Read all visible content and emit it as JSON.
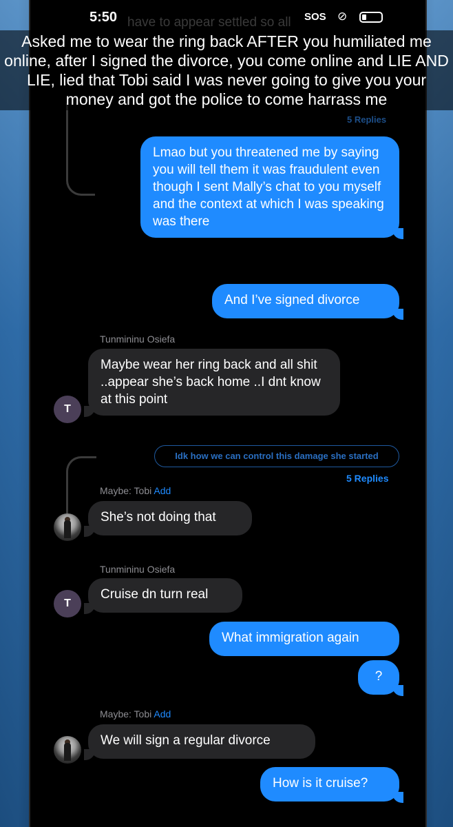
{
  "status_bar": {
    "time": "5:50",
    "sos": "SOS",
    "link_icon": "link-icon",
    "battery_icon": "battery-icon"
  },
  "caption": "Asked me to wear the ring back AFTER you humiliated me online, after I signed the divorce, you come online and LIE AND LIE, lied that Tobi said I was never going to give you your money and got the police to come harrass me",
  "ghost": {
    "text": "have to appear settled so all",
    "replies": "5 Replies"
  },
  "messages": [
    {
      "type": "sent",
      "text": "Lmao but you threatened me by saying you will tell them it was fraudulent even though I sent Mally’s chat to you myself and the context at which I was speaking was there"
    },
    {
      "type": "sent",
      "text": "And I’ve signed divorce"
    },
    {
      "type": "received",
      "sender": "Tunmininu Osiefa",
      "avatar": "T",
      "text": "Maybe wear her ring back and all shit ..appear she’s back home ..I dnt know at this point"
    },
    {
      "type": "thread",
      "text": "Idk how we can control this damage she started",
      "replies": "5 Replies"
    },
    {
      "type": "received",
      "sender": "Maybe: Tobi",
      "sender_action": "Add",
      "text": "She’s not doing that"
    },
    {
      "type": "received",
      "sender": "Tunmininu Osiefa",
      "avatar": "T",
      "text": "Cruise dn turn real"
    },
    {
      "type": "sent",
      "text": "What immigration again"
    },
    {
      "type": "sent",
      "text": "?"
    },
    {
      "type": "received",
      "sender": "Maybe: Tobi",
      "sender_action": "Add",
      "text": "We will sign a regular divorce"
    },
    {
      "type": "sent",
      "text": "How is it cruise?"
    }
  ],
  "colors": {
    "sent_bubble": "#1f8bff",
    "received_bubble": "#262628",
    "background": "#000000",
    "accent": "#1f8bff"
  }
}
